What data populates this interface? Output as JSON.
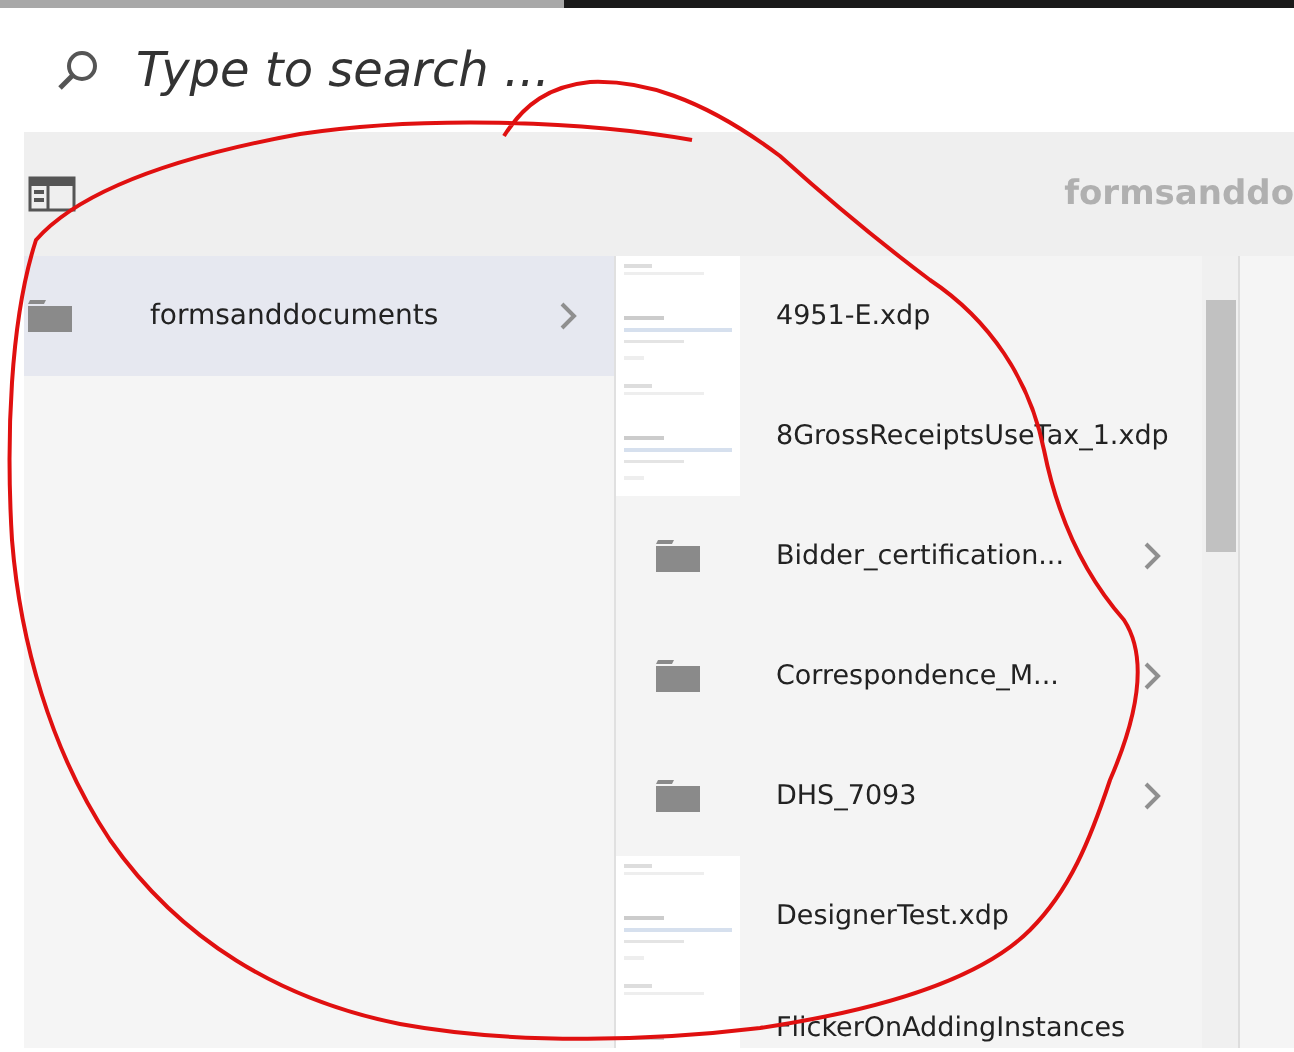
{
  "search": {
    "placeholder": "Type to search ..."
  },
  "header": {
    "title": "formsanddo"
  },
  "folders_column": [
    {
      "label": "formsanddocuments",
      "kind": "folder",
      "selected": true
    }
  ],
  "items_column": [
    {
      "label": "4951-E.xdp",
      "kind": "file"
    },
    {
      "label": "8GrossReceiptsUseTax_1.xdp",
      "kind": "file"
    },
    {
      "label": "Bidder_certification...",
      "kind": "folder"
    },
    {
      "label": "Correspondence_M...",
      "kind": "folder"
    },
    {
      "label": "DHS_7093",
      "kind": "folder"
    },
    {
      "label": "DesignerTest.xdp",
      "kind": "file"
    },
    {
      "label": "FlickerOnAddingInstances",
      "kind": "file"
    }
  ]
}
